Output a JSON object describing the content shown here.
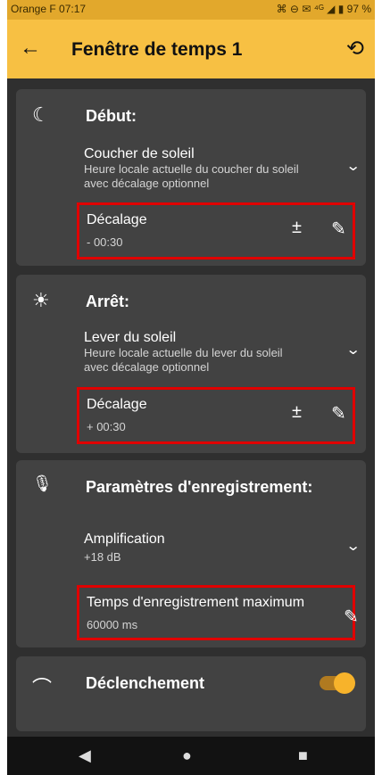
{
  "status_bar": {
    "carrier": "Orange F 07:17",
    "right_icons": "⌘ ⊖ ✉ ⁴ᴳ ◢ ▮ 97 %"
  },
  "app_bar": {
    "title": "Fenêtre de temps 1",
    "back_icon": "←",
    "restore_icon": "⟲"
  },
  "cards": {
    "start": {
      "icon": "☾",
      "title": "Début:",
      "setting_main": "Coucher de soleil",
      "setting_sub_1": "Heure locale actuelle du coucher du soleil",
      "setting_sub_2": "avec décalage optionnel",
      "offset_label": "Décalage",
      "offset_value": "- 00:30"
    },
    "stop": {
      "icon": "☀",
      "title": "Arrêt:",
      "setting_main": "Lever du soleil",
      "setting_sub_1": "Heure locale actuelle du lever du soleil",
      "setting_sub_2": "avec décalage optionnel",
      "offset_label": "Décalage",
      "offset_value": "+ 00:30"
    },
    "recording": {
      "icon": "🎙",
      "title": "Paramètres d'enregistrement:",
      "amp_label": "Amplification",
      "amp_value": "+18 dB",
      "max_label": "Temps d'enregistrement maximum",
      "max_value": "60000 ms"
    },
    "trigger": {
      "icon": "⌒",
      "title": "Déclenchement",
      "enabled": true
    }
  },
  "symbols": {
    "chevron": "⌄",
    "plus_minus": "±",
    "edit": "✎"
  },
  "nav": {
    "back": "◀",
    "home": "●",
    "recents": "■"
  },
  "colors": {
    "accent": "#f7c043",
    "highlight": "#e00000",
    "card": "#424242",
    "bg": "#2f2f2f"
  }
}
